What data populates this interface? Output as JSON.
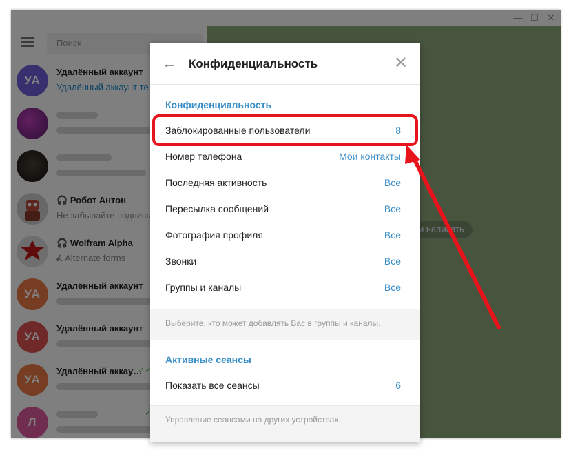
{
  "window": {
    "minimize_glyph": "—",
    "maximize_glyph": "☐",
    "close_glyph": "✕"
  },
  "sidebar": {
    "search_placeholder": "Поиск",
    "chats": [
      {
        "avatar_text": "УА",
        "avatar_color": "#6c61df",
        "name": "Удалённый аккаунт",
        "preview": "Удалённый аккаунт те",
        "preview_is_link": true
      },
      {
        "avatar_text": "",
        "avatar_color": "#8a2f8f",
        "name": "",
        "preview": "",
        "blurred": true
      },
      {
        "avatar_text": "",
        "avatar_color": "#2a2620",
        "name": "",
        "preview": "",
        "blurred": true
      },
      {
        "avatar_text": "",
        "avatar_color": "#c9c9c9",
        "name": "Робот Антон",
        "preview": "Не забывайте подпись",
        "bot": true
      },
      {
        "avatar_text": "",
        "avatar_color": "#d9d9d9",
        "name": "Wolfram Alpha",
        "preview": "Alternate forms",
        "bot": true
      },
      {
        "avatar_text": "УА",
        "avatar_color": "#ed7a45",
        "name": "Удалённый аккаунт",
        "preview": ""
      },
      {
        "avatar_text": "УА",
        "avatar_color": "#e05252",
        "name": "Удалённый аккаунт",
        "preview": ""
      },
      {
        "avatar_text": "УА",
        "avatar_color": "#ed7a45",
        "name": "Удалённый аккау…",
        "preview": "",
        "check": true
      },
      {
        "avatar_text": "Л",
        "avatar_color": "#e05aa0",
        "name": "",
        "preview": "",
        "blurred": true,
        "check": true
      }
    ]
  },
  "chat_area": {
    "hint": "и написать"
  },
  "dialog": {
    "title": "Конфиденциальность",
    "privacy_section_title": "Конфиденциальность",
    "privacy_rows": [
      {
        "label": "Заблокированные пользователи",
        "value": "8"
      },
      {
        "label": "Номер телефона",
        "value": "Мои контакты"
      },
      {
        "label": "Последняя активность",
        "value": "Все"
      },
      {
        "label": "Пересылка сообщений",
        "value": "Все"
      },
      {
        "label": "Фотография профиля",
        "value": "Все"
      },
      {
        "label": "Звонки",
        "value": "Все"
      },
      {
        "label": "Группы и каналы",
        "value": "Все"
      }
    ],
    "groups_note": "Выберите, кто может добавлять Вас в группы и каналы.",
    "sessions_section_title": "Активные сеансы",
    "sessions_row": {
      "label": "Показать все сеансы",
      "value": "6"
    },
    "sessions_note": "Управление сеансами на других устройствах."
  },
  "colors": {
    "accent": "#3a8fc8",
    "highlight": "#e8141b",
    "chat_background": "#8fa97d"
  }
}
